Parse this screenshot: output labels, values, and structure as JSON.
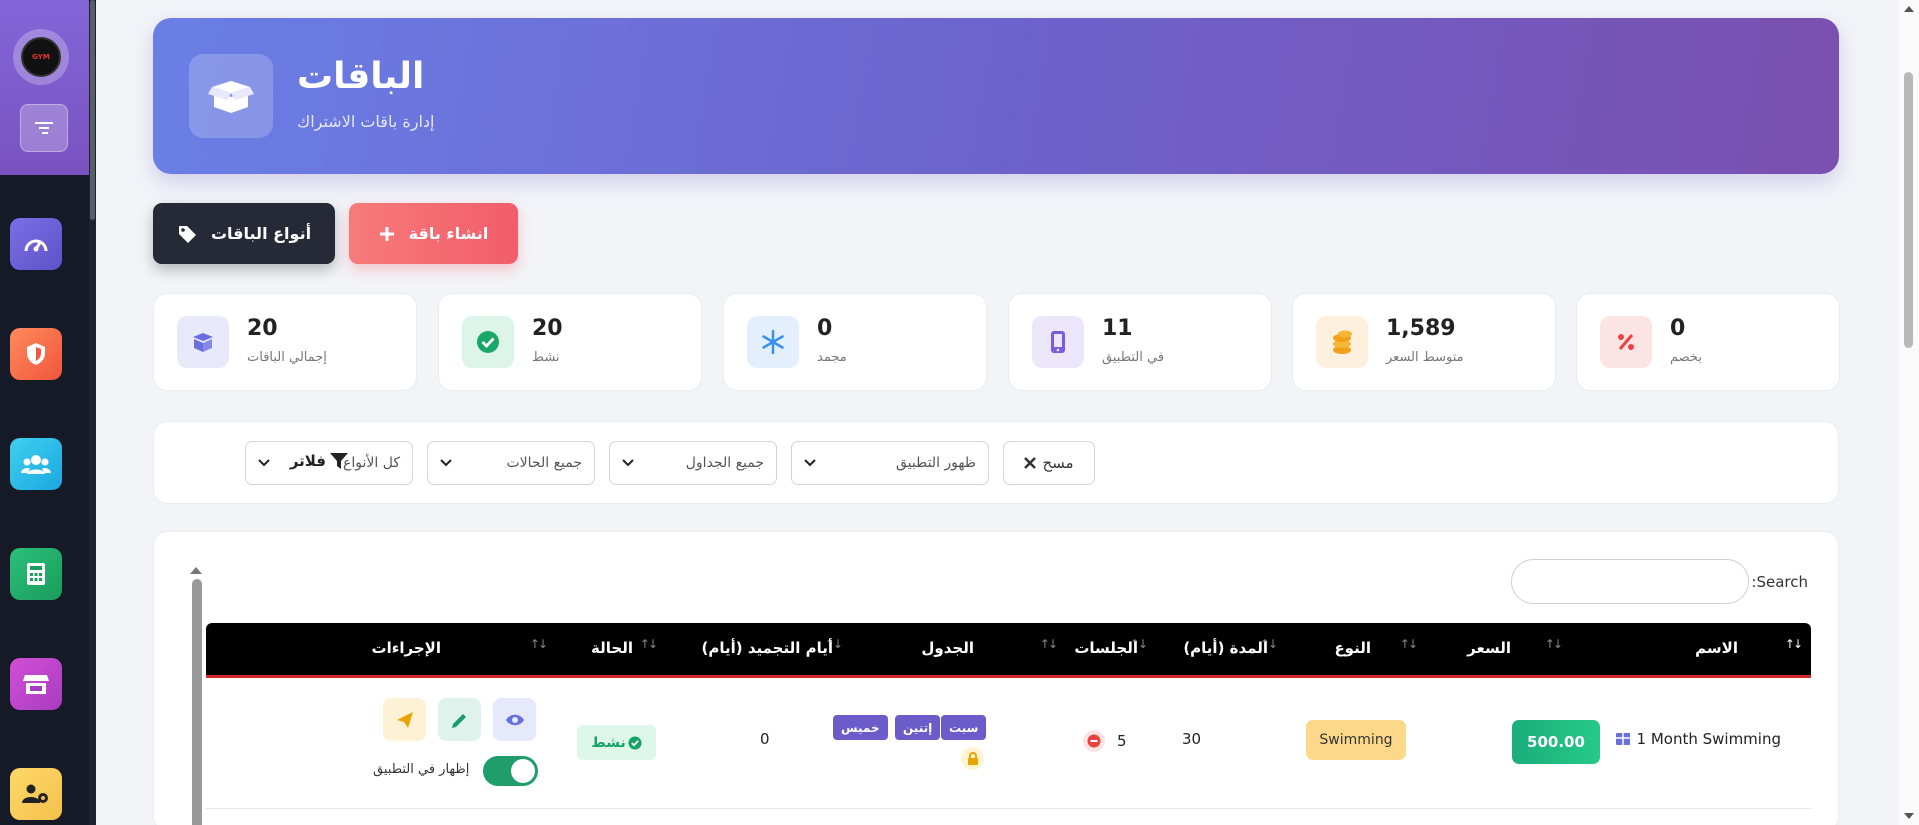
{
  "brand": {
    "logo_text": "GYM"
  },
  "header": {
    "title": "الباقات",
    "subtitle": "إدارة باقات الاشتراك"
  },
  "actions": {
    "create_label": "انشاء باقة",
    "types_label": "أنواع الباقات"
  },
  "stats": [
    {
      "value": "0",
      "label": "بخصم",
      "icon": "percent-icon",
      "color": "#e8433f"
    },
    {
      "value": "1,589",
      "label": "متوسط السعر",
      "icon": "coins-icon",
      "color": "#f2a019"
    },
    {
      "value": "11",
      "label": "في التطبيق",
      "icon": "phone-icon",
      "color": "#7b5ce0"
    },
    {
      "value": "0",
      "label": "مجمد",
      "icon": "snowflake-icon",
      "color": "#3b8ef0"
    },
    {
      "value": "20",
      "label": "نشط",
      "icon": "check-circle-icon",
      "color": "#19a868"
    },
    {
      "value": "20",
      "label": "إجمالي الباقات",
      "icon": "box-icon",
      "color": "#6a6fe0"
    }
  ],
  "filters": {
    "label": "فلاتر",
    "types": "كل الأنواع",
    "statuses": "جميع الحالات",
    "schedules": "جميع الجداول",
    "app_visibility": "ظهور التطبيق",
    "clear_label": "مسح"
  },
  "table": {
    "search_label": "Search:",
    "columns": {
      "name": "الاسم",
      "price": "السعر",
      "type": "النوع",
      "duration": "المدة (أيام)",
      "sessions": "الجلسات",
      "schedule": "الجدول",
      "freeze": "أيام التجميد (أيام)",
      "status": "الحالة",
      "actions": "الإجراءات"
    },
    "rows": [
      {
        "name": "1 Month Swimming",
        "price": "500.00",
        "type": "Swimming",
        "duration": "30",
        "sessions": "5",
        "days": [
          "سبت",
          "إتنين",
          "خميس"
        ],
        "freeze": "0",
        "status": "نشط",
        "show_in_app_label": "إظهار في التطبيق"
      }
    ]
  }
}
